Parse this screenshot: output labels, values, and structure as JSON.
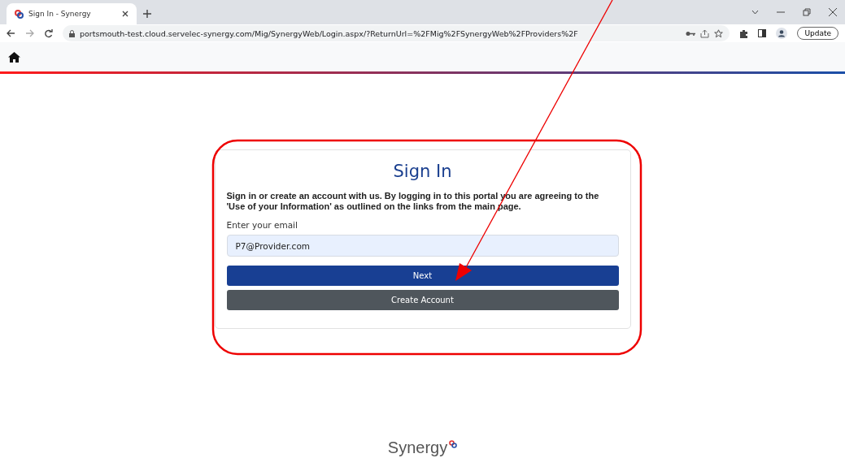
{
  "browser": {
    "tab_title": "Sign In - Synergy",
    "url": "portsmouth-test.cloud.servelec-synergy.com/Mig/SynergyWeb/Login.aspx/?ReturnUrl=%2FMig%2FSynergyWeb%2FProviders%2F",
    "update_label": "Update"
  },
  "signin": {
    "title": "Sign In",
    "intro": "Sign in or create an account with us. By logging in to this portal you are agreeing to the 'Use of your Information' as outlined on the links from the main page.",
    "email_label": "Enter your email",
    "email_value": "P7@Provider.com",
    "buttons": [
      {
        "label": "Next",
        "kind": "primary"
      },
      {
        "label": "Create Account",
        "kind": "secondary"
      }
    ]
  },
  "footer": {
    "logo_text": "Synergy"
  }
}
